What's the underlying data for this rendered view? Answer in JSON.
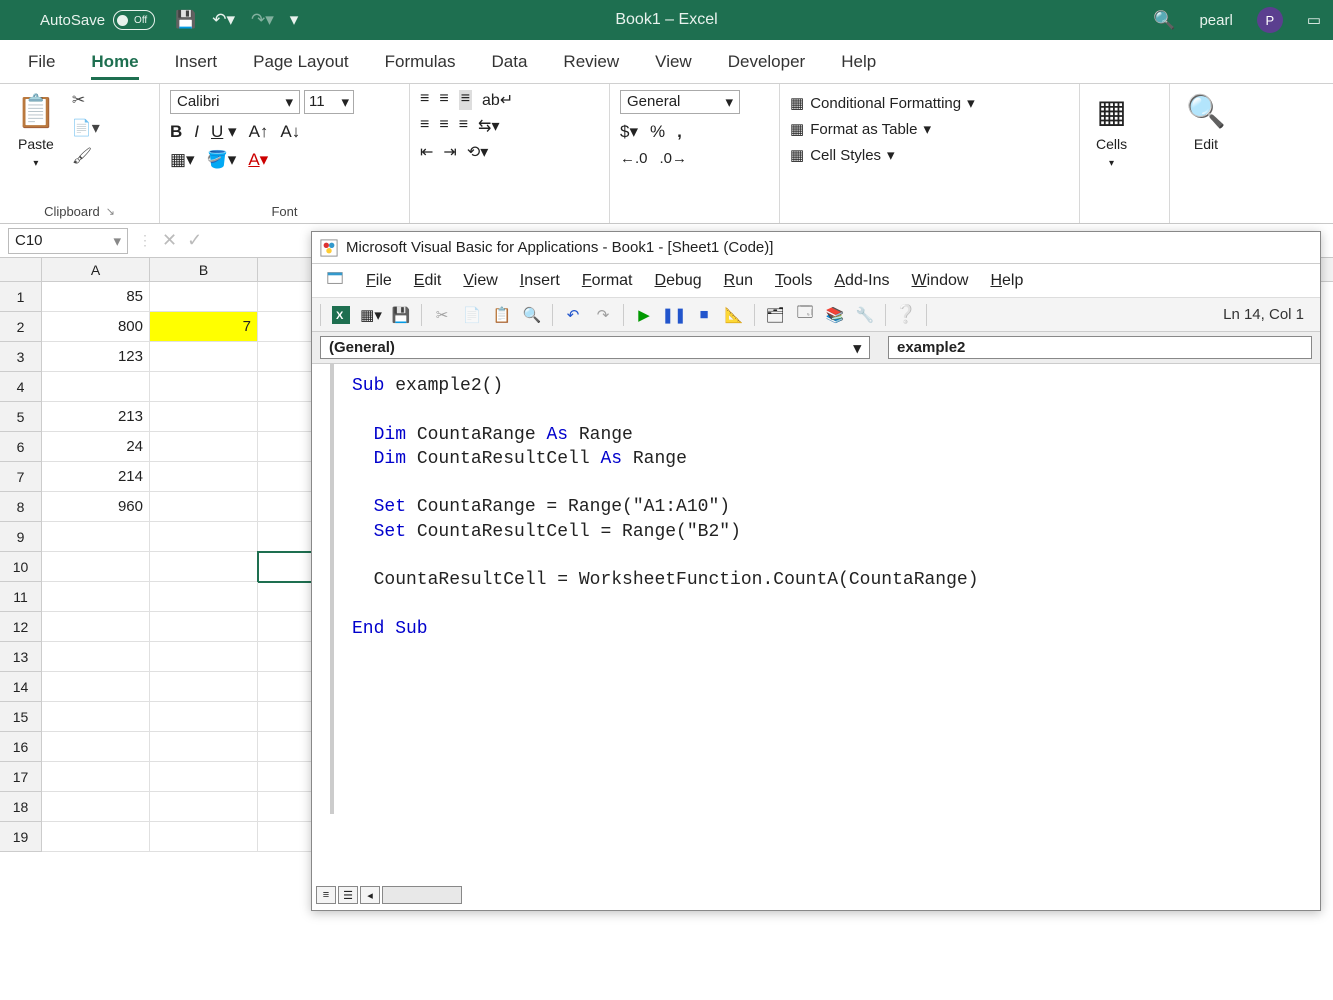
{
  "titlebar": {
    "autosave": "AutoSave",
    "autosave_state": "Off",
    "app_title": "Book1 – Excel",
    "user": "pearl",
    "user_initial": "P"
  },
  "tabs": [
    "File",
    "Home",
    "Insert",
    "Page Layout",
    "Formulas",
    "Data",
    "Review",
    "View",
    "Developer",
    "Help"
  ],
  "active_tab": "Home",
  "ribbon": {
    "paste": "Paste",
    "clipboard": "Clipboard",
    "font_name": "Calibri",
    "font_size": "11",
    "font_group": "Font",
    "number_format": "General",
    "cond_fmt": "Conditional Formatting",
    "format_table": "Format as Table",
    "cell_styles": "Cell Styles",
    "cells": "Cells",
    "edit": "Edit"
  },
  "namebar": {
    "cell_ref": "C10"
  },
  "grid": {
    "cols": [
      "A",
      "B"
    ],
    "rows": [
      {
        "n": "1",
        "A": "85",
        "B": ""
      },
      {
        "n": "2",
        "A": "800",
        "B": "7",
        "hlB": true
      },
      {
        "n": "3",
        "A": "123",
        "B": ""
      },
      {
        "n": "4",
        "A": "",
        "B": ""
      },
      {
        "n": "5",
        "A": "213",
        "B": ""
      },
      {
        "n": "6",
        "A": "24",
        "B": ""
      },
      {
        "n": "7",
        "A": "214",
        "B": ""
      },
      {
        "n": "8",
        "A": "960",
        "B": ""
      },
      {
        "n": "9",
        "A": "",
        "B": ""
      },
      {
        "n": "10",
        "A": "",
        "B": "",
        "selC": true
      },
      {
        "n": "11",
        "A": "",
        "B": ""
      },
      {
        "n": "12",
        "A": "",
        "B": ""
      },
      {
        "n": "13",
        "A": "",
        "B": ""
      },
      {
        "n": "14",
        "A": "",
        "B": ""
      },
      {
        "n": "15",
        "A": "",
        "B": ""
      },
      {
        "n": "16",
        "A": "",
        "B": ""
      },
      {
        "n": "17",
        "A": "",
        "B": ""
      },
      {
        "n": "18",
        "A": "",
        "B": ""
      },
      {
        "n": "19",
        "A": "",
        "B": ""
      }
    ]
  },
  "vba": {
    "title": "Microsoft Visual Basic for Applications - Book1 - [Sheet1 (Code)]",
    "menu": [
      "File",
      "Edit",
      "View",
      "Insert",
      "Format",
      "Debug",
      "Run",
      "Tools",
      "Add-Ins",
      "Window",
      "Help"
    ],
    "status": "Ln 14, Col 1",
    "combo_left": "(General)",
    "combo_right": "example2",
    "code_lines": [
      {
        "t": "Sub ",
        "k": true,
        "rest": "example2()"
      },
      {
        "t": "",
        "rest": ""
      },
      {
        "t": "  Dim ",
        "k": true,
        "rest": "CountaRange ",
        "k2": "As ",
        "rest2": "Range"
      },
      {
        "t": "  Dim ",
        "k": true,
        "rest": "CountaResultCell ",
        "k2": "As ",
        "rest2": "Range"
      },
      {
        "t": "",
        "rest": ""
      },
      {
        "t": "  Set ",
        "k": true,
        "rest": "CountaRange = Range(\"A1:A10\")"
      },
      {
        "t": "  Set ",
        "k": true,
        "rest": "CountaResultCell = Range(\"B2\")"
      },
      {
        "t": "",
        "rest": ""
      },
      {
        "t": "  ",
        "rest": "CountaResultCell = WorksheetFunction.CountA(CountaRange)"
      },
      {
        "t": "",
        "rest": ""
      },
      {
        "t": "End Sub",
        "k": true,
        "rest": ""
      }
    ]
  }
}
